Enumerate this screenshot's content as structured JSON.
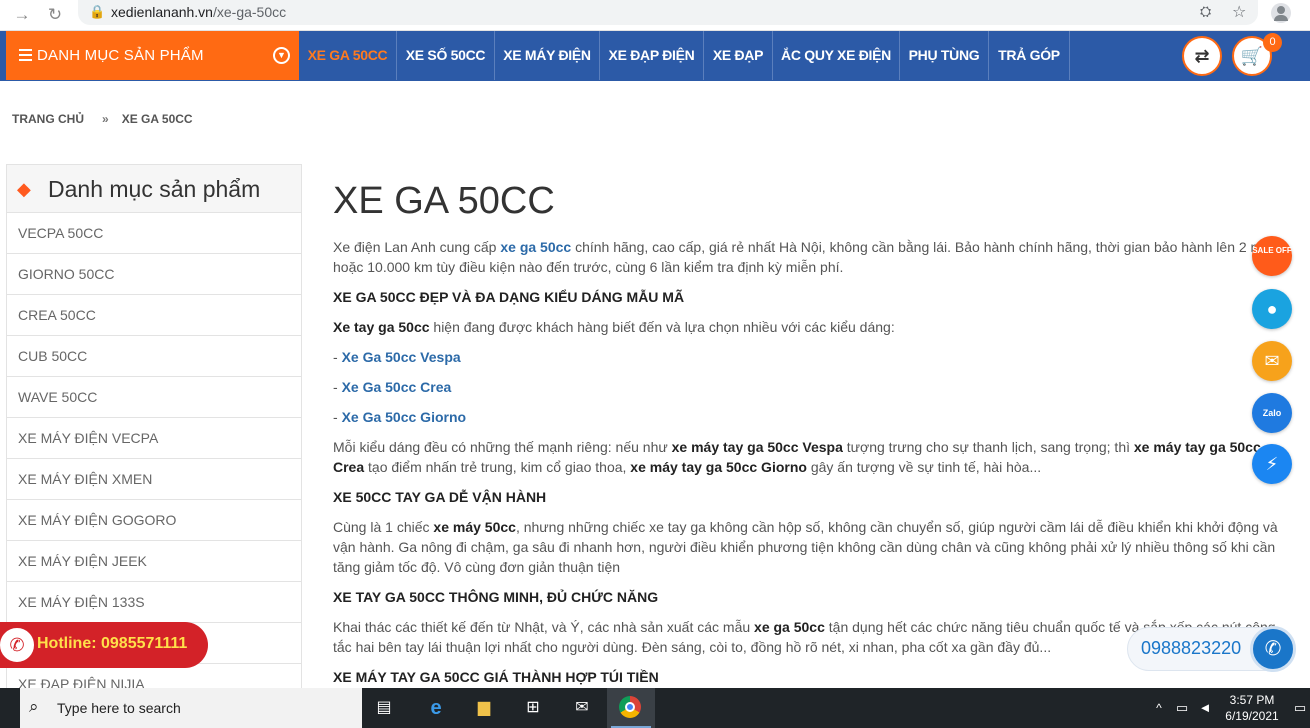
{
  "browser": {
    "url_host": "xedienlananh.vn",
    "url_path": "/xe-ga-50cc"
  },
  "menu": {
    "category_label": "DANH MỤC SẢN PHẨM",
    "items": [
      "XE GA 50CC",
      "XE SỐ 50CC",
      "XE MÁY ĐIỆN",
      "XE ĐẠP ĐIỆN",
      "XE ĐẠP",
      "ẮC QUY XE ĐIỆN",
      "PHỤ TÙNG",
      "TRẢ GÓP"
    ],
    "cart_count": "0"
  },
  "breadcrumb": {
    "home": "TRANG CHỦ",
    "sep": "»",
    "current": "XE GA 50CC"
  },
  "sidebar": {
    "title": "Danh mục sản phẩm",
    "items": [
      "VECPA 50CC",
      "GIORNO 50CC",
      "CREA 50CC",
      "CUB 50CC",
      "WAVE 50CC",
      "XE MÁY ĐIỆN VECPA",
      "XE MÁY ĐIỆN XMEN",
      "XE MÁY ĐIỆN GOGORO",
      "XE MÁY ĐIỆN JEEK",
      "XE MÁY ĐIỆN 133S",
      "",
      "XE ĐẠP ĐIỆN NIJIA"
    ]
  },
  "content": {
    "title": "XE GA 50CC",
    "intro_a": "Xe điện Lan Anh cung cấp ",
    "intro_link": "xe ga 50cc",
    "intro_b": " chính hãng, cao cấp, giá rẻ nhất Hà Nội, không cần bằng lái. Bảo hành chính hãng, thời gian bảo hành lên 2 năm hoặc 10.000 km tùy điều kiện nào đến trước, cùng 6 lần kiểm tra định kỳ miễn phí.",
    "h1": "XE GA 50CC ĐẸP VÀ ĐA DẠNG KIỂU DÁNG MẪU MÃ",
    "p2_bold": "Xe tay ga 50cc",
    "p2_rest": " hiện đang được khách hàng biết đến và lựa chọn nhiều với các kiểu dáng:",
    "dash": "- ",
    "list": [
      "Xe Ga 50cc Vespa",
      "Xe Ga 50cc Crea",
      "Xe Ga 50cc Giorno"
    ],
    "p3_a": "Mỗi kiểu dáng đều có những thế mạnh riêng: nếu như ",
    "p3_b1": "xe máy tay ga 50cc Vespa",
    "p3_c": " tượng trưng cho sự  thanh lịch, sang trọng; thì ",
    "p3_b2": "xe máy tay ga 50cc Crea",
    "p3_d": " tạo điểm nhấn trẻ trung, kim cổ giao thoa, ",
    "p3_b3": "xe máy tay ga 50cc Giorno",
    "p3_e": " gây ấn tượng về sự tinh tế, hài hòa...",
    "h2": "XE 50CC TAY GA DỄ VẬN HÀNH",
    "p4_a": "Cùng là 1 chiếc ",
    "p4_b": "xe máy 50cc",
    "p4_c": ", nhưng những chiếc xe tay ga không cần hộp số, không cần chuyển số, giúp người cầm lái dễ điều khiển khi khởi động và vận hành. Ga nông đi chậm, ga sâu đi nhanh hơn, người điều khiển phương tiện không cần dùng chân và cũng không phải xử lý nhiều thông số khi cần tăng giảm tốc độ. Vô cùng đơn giản thuận tiện",
    "h3": "XE TAY GA 50CC THÔNG MINH, ĐỦ CHỨC NĂNG",
    "p5_a": "Khai thác các thiết kế đến từ Nhật, và Ý, các nhà sản xuất các mẫu ",
    "p5_b": "xe ga 50cc",
    "p5_c": " tận dụng hết các chức năng tiêu chuẩn quốc tế và sắp xếp các nút công tắc hai bên tay lái thuận lợi nhất cho người dùng. Đèn sáng, còi to, đồng hồ rõ nét, xi nhan, pha cốt xa gần đầy đủ...",
    "h4": "XE MÁY TAY GA 50CC GIÁ THÀNH HỢP TÚI TIỀN"
  },
  "floating": {
    "sale_label": "SALE OFF",
    "zalo_label": "Zalo",
    "hotline": "Hotline: 0985571111",
    "phone": "0988823220"
  },
  "taskbar": {
    "search_placeholder": "Type here to search",
    "time": "3:57 PM",
    "date": "6/19/2021"
  },
  "colors": {
    "menu_blue": "#2c5aa7",
    "accent_orange": "#ff6a13",
    "link_blue": "#2c6aa8",
    "hotline_red": "#d32228"
  }
}
